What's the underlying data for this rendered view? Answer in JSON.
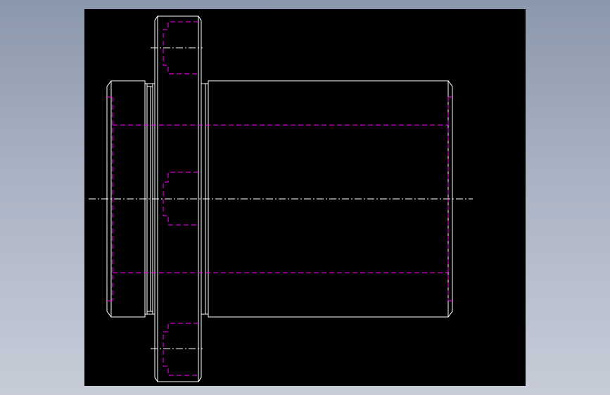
{
  "drawing": {
    "background": "#000000",
    "outline_color": "#ffffff",
    "hidden_line_color": "#ff00ff",
    "centerline_color": "#ffffff",
    "views": [
      "bushing-side-view"
    ],
    "line_types": [
      "outline",
      "hidden",
      "centerline"
    ]
  }
}
